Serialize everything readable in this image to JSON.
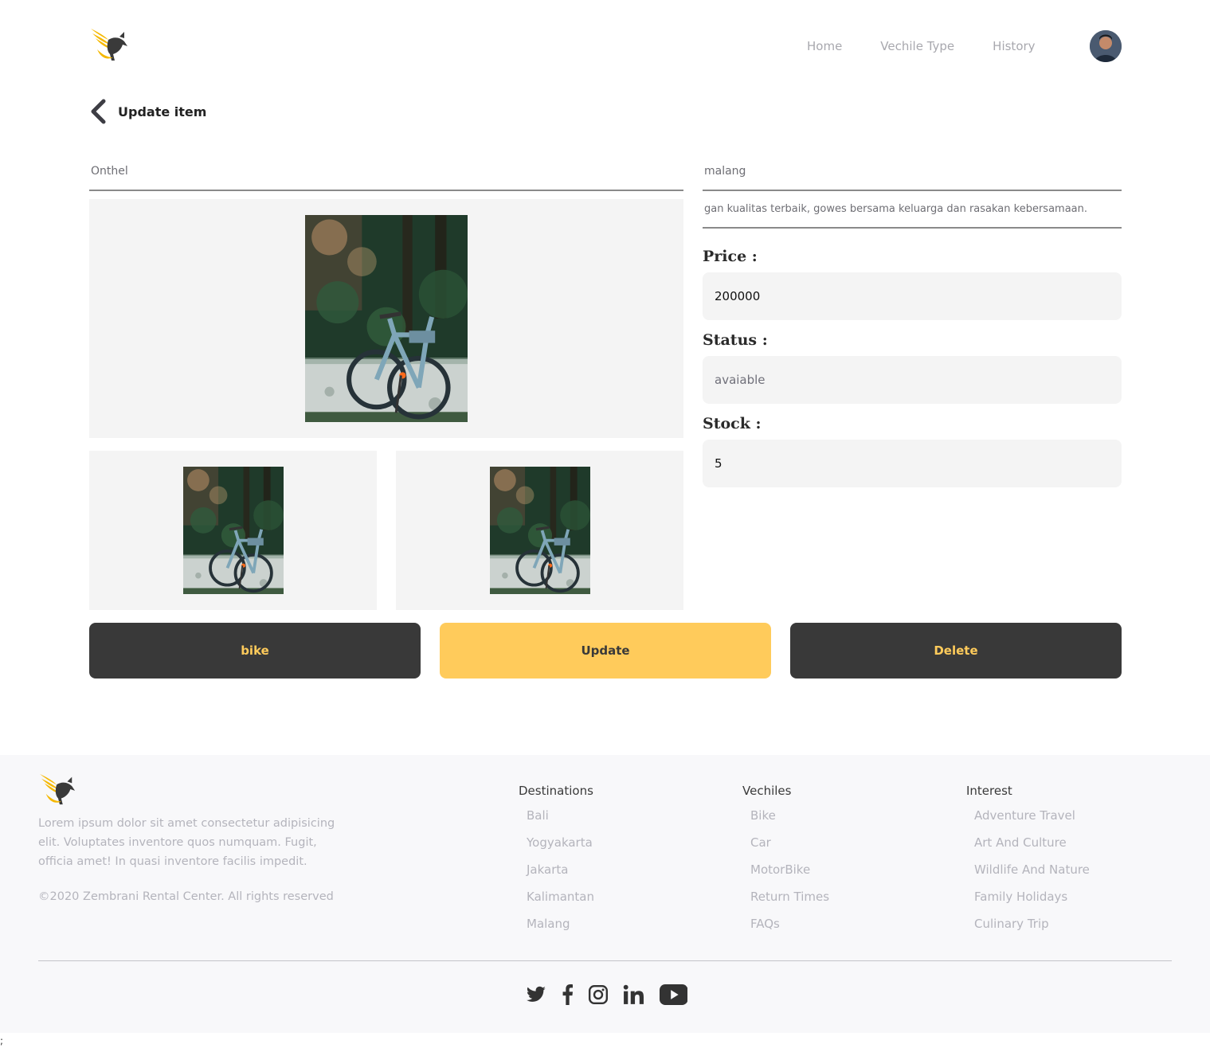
{
  "header": {
    "logo_icon": "winged-horse-logo",
    "nav": [
      "Home",
      "Vechile Type",
      "History"
    ],
    "avatar_icon": "user-avatar"
  },
  "page": {
    "back_icon": "chevron-left-icon",
    "title": "Update item"
  },
  "item": {
    "name": "Onthel",
    "location": "malang",
    "description": "gan kualitas terbaik, gowes bersama keluarga dan rasakan kebersamaan.",
    "price_label": "Price :",
    "price": "200000",
    "status_label": "Status :",
    "status": "avaiable",
    "stock_label": "Stock :",
    "stock": "5",
    "image_icon": "bicycle-photo"
  },
  "actions": {
    "type_label": "bike",
    "update_label": "Update",
    "delete_label": "Delete"
  },
  "colors": {
    "accent": "#ffcb5b",
    "dark": "#393939",
    "input_bg": "#f4f4f4",
    "footer_bg": "#f8f8fa"
  },
  "footer": {
    "description": "Lorem ipsum dolor sit amet consectetur adipisicing elit. Voluptates inventore quos numquam. Fugit, officia amet! In quasi inventore facilis impedit.",
    "copyright": "©2020 Zembrani Rental Center. All rights reserved",
    "columns": [
      {
        "title": "Destinations",
        "items": [
          "Bali",
          "Yogyakarta",
          "Jakarta",
          "Kalimantan",
          "Malang"
        ]
      },
      {
        "title": "Vechiles",
        "items": [
          "Bike",
          "Car",
          "MotorBike",
          "Return Times",
          "FAQs"
        ]
      },
      {
        "title": "Interest",
        "items": [
          "Adventure Travel",
          "Art And Culture",
          "Wildlife And Nature",
          "Family Holidays",
          "Culinary Trip"
        ]
      }
    ],
    "social_icons": [
      "twitter-icon",
      "facebook-icon",
      "instagram-icon",
      "linkedin-icon",
      "youtube-icon"
    ]
  },
  "stray_text": ";"
}
